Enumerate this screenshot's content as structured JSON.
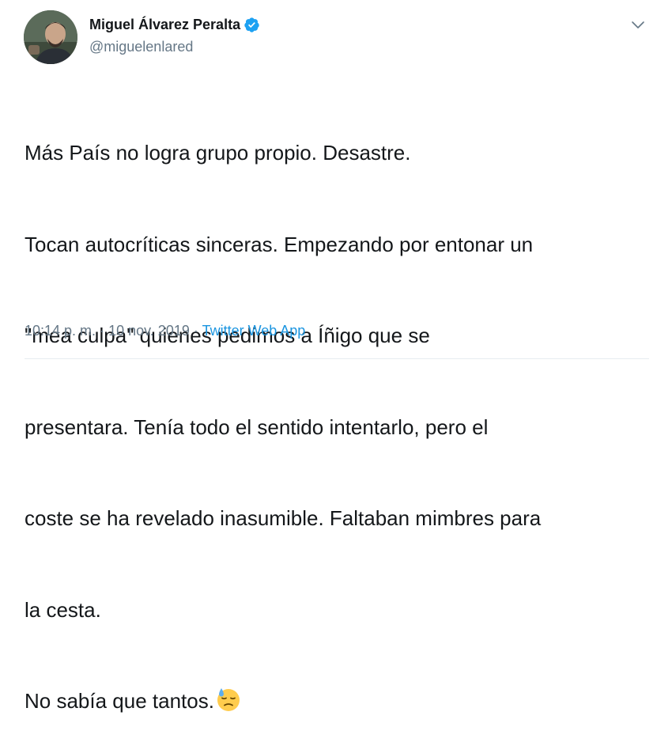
{
  "author": {
    "display_name": "Miguel Álvarez Peralta",
    "handle": "@miguelenlared",
    "verified": true
  },
  "tweet": {
    "lines": [
      "Más País no logra grupo propio. Desastre.",
      "Tocan autocríticas sinceras. Empezando por entonar un",
      "\"mea culpa\" quienes pedimos a Íñigo que se",
      "presentara. Tenía todo el sentido intentarlo, pero el",
      "coste se ha revelado inasumible. Faltaban mimbres para",
      "la cesta.",
      "No sabía que tantos."
    ],
    "emoji": "downcast-face-with-sweat"
  },
  "meta": {
    "time": "10:14 p. m.",
    "separator": "·",
    "date": "10 nov. 2019",
    "source": "Twitter Web App"
  },
  "icons": {
    "verified": "verified-badge-icon",
    "more": "chevron-down-icon"
  },
  "colors": {
    "text": "#14171a",
    "secondary": "#657786",
    "link": "#1b95e0",
    "verified": "#1da1f2"
  }
}
